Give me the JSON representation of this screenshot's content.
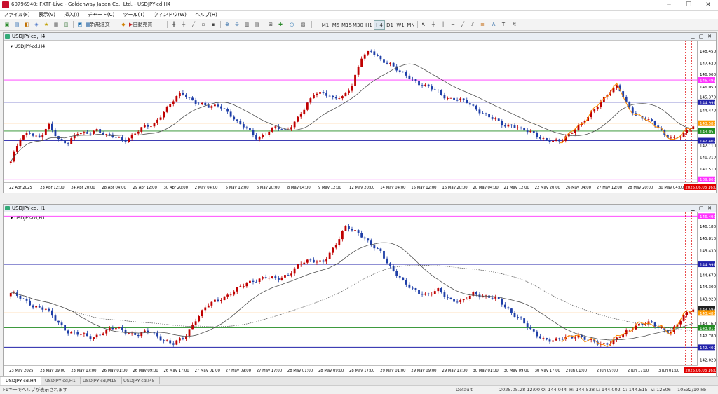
{
  "window": {
    "title": "60796940: FXTF-Live - Goldenway Japan Co., Ltd. - USDJPY-cd,H4",
    "minimize": "─",
    "maximize": "☐",
    "close": "✕"
  },
  "menu": [
    "ファイル(F)",
    "表示(V)",
    "挿入(I)",
    "チャート(C)",
    "ツール(T)",
    "ウィンドウ(W)",
    "ヘルプ(H)"
  ],
  "toolbar": {
    "new_order": "新規注文",
    "auto_trade": "自動売買",
    "timeframes": [
      "M1",
      "M5",
      "M15",
      "M30",
      "H1",
      "H4",
      "D1",
      "W1",
      "MN"
    ],
    "active_timeframe": "H4"
  },
  "top_chart": {
    "title": "USDJPY-cd,H4",
    "label": "USDJPY-cd,H4",
    "price_labels": [
      {
        "value": "148.450",
        "price": 148.45
      },
      {
        "value": "147.620",
        "price": 147.62
      },
      {
        "value": "146.900",
        "price": 146.9
      },
      {
        "value": "146.492",
        "price": 146.492,
        "bg": "#ff33ff"
      },
      {
        "value": "146.050",
        "price": 146.05
      },
      {
        "value": "145.370",
        "price": 145.37
      },
      {
        "value": "144.991",
        "price": 144.991,
        "bg": "#2222aa"
      },
      {
        "value": "144.470",
        "price": 144.47
      },
      {
        "value": "143.580",
        "price": 143.58,
        "bg": "#ff9900"
      },
      {
        "value": "143.050",
        "price": 143.05,
        "bg": "#228b22"
      },
      {
        "value": "142.409",
        "price": 142.409,
        "bg": "#2222aa"
      },
      {
        "value": "142.110",
        "price": 142.11
      },
      {
        "value": "141.310",
        "price": 141.31
      },
      {
        "value": "140.510",
        "price": 140.51
      },
      {
        "value": "139.803",
        "price": 139.803,
        "bg": "#ff33ff"
      }
    ],
    "time_labels": [
      "22 Apr 2025",
      "23 Apr 12:00",
      "24 Apr 20:00",
      "28 Apr 04:00",
      "29 Apr 12:00",
      "30 Apr 20:00",
      "2 May 04:00",
      "5 May 12:00",
      "6 May 20:00",
      "8 May 04:00",
      "9 May 12:00",
      "12 May 20:00",
      "14 May 04:00",
      "15 May 12:00",
      "16 May 20:00",
      "20 May 04:00",
      "21 May 12:00",
      "22 May 20:00",
      "26 May 04:00",
      "27 May 12:00",
      "28 May 20:00",
      "30 May 04:00"
    ],
    "cursor_time": "2025.06.03 16:00"
  },
  "bottom_chart": {
    "title": "USDJPY-cd,H1",
    "label": "USDJPY-cd,H1",
    "price_labels": [
      {
        "value": "146.492",
        "price": 146.492,
        "bg": "#ff33ff"
      },
      {
        "value": "146.180",
        "price": 146.18
      },
      {
        "value": "145.810",
        "price": 145.81
      },
      {
        "value": "145.430",
        "price": 145.43
      },
      {
        "value": "144.991",
        "price": 144.991,
        "bg": "#2222aa"
      },
      {
        "value": "144.670",
        "price": 144.67
      },
      {
        "value": "144.300",
        "price": 144.3
      },
      {
        "value": "143.920",
        "price": 143.92
      },
      {
        "value": "143.597",
        "price": 143.597,
        "bg": "#222222"
      },
      {
        "value": "143.480",
        "price": 143.48,
        "bg": "#ff9900"
      },
      {
        "value": "143.160",
        "price": 143.16
      },
      {
        "value": "143.016",
        "price": 143.016,
        "bg": "#228b22"
      },
      {
        "value": "142.780",
        "price": 142.78
      },
      {
        "value": "142.409",
        "price": 142.409,
        "bg": "#2222aa"
      },
      {
        "value": "142.020",
        "price": 142.02
      }
    ],
    "time_labels": [
      "23 May 2025",
      "23 May 09:00",
      "23 May 17:00",
      "26 May 01:00",
      "26 May 09:00",
      "26 May 17:00",
      "27 May 01:00",
      "27 May 09:00",
      "27 May 17:00",
      "28 May 01:00",
      "28 May 09:00",
      "28 May 17:00",
      "29 May 01:00",
      "29 May 09:00",
      "29 May 17:00",
      "30 May 01:00",
      "30 May 09:00",
      "30 May 17:00",
      "2 Jun 01:00",
      "2 Jun 09:00",
      "2 Jun 17:00",
      "3 Jun 01:00"
    ],
    "cursor_time": "2025.06.03 16:00"
  },
  "tabs": [
    "USDJPY-cd,H4",
    "USDJPY-cd,H1",
    "USDJPY-cd,M15",
    "USDJPY-cd,M5"
  ],
  "active_tab": "USDJPY-cd,H4",
  "status": {
    "help": "F1キーでヘルプが表示されます",
    "profile": "Default",
    "datetime": "2025.05.28 12:00",
    "open": "O: 144.044",
    "high": "H: 144.538",
    "low": "L: 144.002",
    "close": "C: 144.515",
    "volume": "V: 12506",
    "traffic": "10532/10 kb"
  },
  "colors": {
    "bull": "#c00000",
    "bear": "#1f3fa8",
    "ma": "#505050",
    "orange": "#ff8c00",
    "magenta": "#ff33ff",
    "blue": "#2222aa",
    "green": "#228b22",
    "cursor": "#e00000"
  },
  "chart_data": [
    {
      "type": "candlestick",
      "title": "USDJPY-cd,H4",
      "ylim": [
        139.6,
        148.95
      ],
      "horizontal_lines": [
        146.492,
        144.991,
        143.58,
        143.05,
        142.409,
        139.803
      ],
      "close_path": [
        141.0,
        142.5,
        143.0,
        142.6,
        143.4,
        142.5,
        142.3,
        142.9,
        142.8,
        143.2,
        142.8,
        142.6,
        142.4,
        142.9,
        143.3,
        143.4,
        144.3,
        145.0,
        145.6,
        145.2,
        144.9,
        144.6,
        144.8,
        144.3,
        143.5,
        143.2,
        142.6,
        142.9,
        143.3,
        143.1,
        143.7,
        144.5,
        145.6,
        145.7,
        145.2,
        145.3,
        146.2,
        148.0,
        148.4,
        147.9,
        147.6,
        147.0,
        146.7,
        146.3,
        146.0,
        145.7,
        145.3,
        145.2,
        145.0,
        144.6,
        144.2,
        143.8,
        143.4,
        143.5,
        143.1,
        142.9,
        142.6,
        142.4,
        142.3,
        142.9,
        143.5,
        144.0,
        144.8,
        145.7,
        146.1,
        144.8,
        144.1,
        143.9,
        143.4,
        142.8,
        142.6,
        142.8,
        143.4
      ]
    },
    {
      "type": "candlestick",
      "title": "USDJPY-cd,H1",
      "ylim": [
        141.85,
        146.52
      ],
      "horizontal_lines": [
        146.492,
        144.991,
        143.48,
        143.016,
        142.409
      ],
      "close_path": [
        144.1,
        143.9,
        143.7,
        143.6,
        143.2,
        142.9,
        142.8,
        142.7,
        142.9,
        143.0,
        142.9,
        142.8,
        142.9,
        142.7,
        142.5,
        142.7,
        143.3,
        143.7,
        143.9,
        144.1,
        144.3,
        144.5,
        144.6,
        144.5,
        144.7,
        145.0,
        145.1,
        145.1,
        145.5,
        146.2,
        146.0,
        145.6,
        145.4,
        144.8,
        144.4,
        144.2,
        144.0,
        144.2,
        143.9,
        143.8,
        144.1,
        144.0,
        143.9,
        143.6,
        143.3,
        142.9,
        142.7,
        142.6,
        142.7,
        142.8,
        142.6,
        142.5,
        142.6,
        142.8,
        143.1,
        143.2,
        143.0,
        142.9,
        143.3,
        143.6
      ]
    }
  ]
}
